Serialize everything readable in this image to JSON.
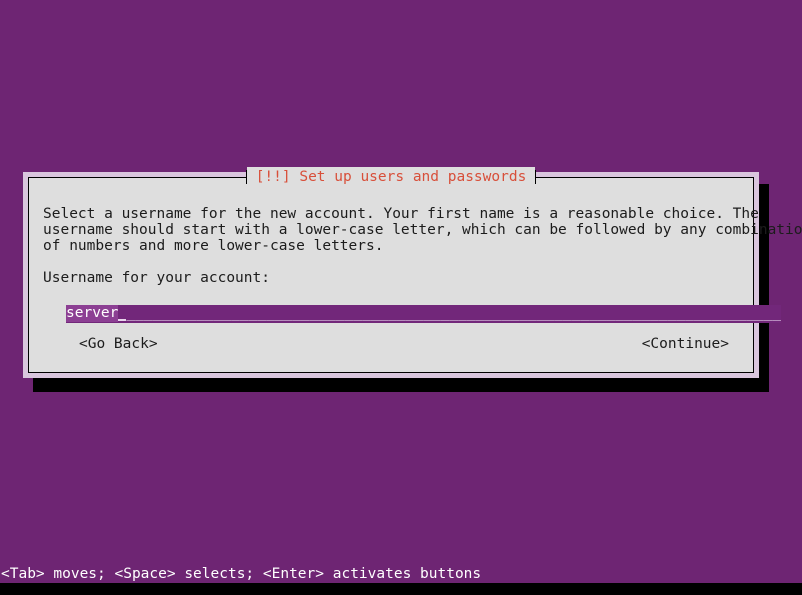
{
  "screen": {
    "background_color": "#6e2573",
    "bottom_strip_color": "#000000"
  },
  "dialog": {
    "title": "[!!] Set up users and passwords",
    "title_color": "#d84f3a",
    "frame_color": "#d9c6dd",
    "panel_color": "#dedede",
    "border_color": "#000000",
    "shadow_color": "#000000",
    "body_lines": [
      "Select a username for the new account. Your first name is a reasonable choice. The",
      "username should start with a lower-case letter, which can be followed by any combination",
      "of numbers and more lower-case letters."
    ],
    "prompt_label": "Username for your account:",
    "input": {
      "value": "server",
      "placeholder": "",
      "selected": true,
      "selection_color": "#8c3f93",
      "field_color": "#72277a",
      "text_color": "#ffffff",
      "blank_color": "#e8d5ec",
      "blank_fill": "_________________________________________________________________________________"
    },
    "buttons": {
      "go_back": "<Go Back>",
      "continue": "<Continue>"
    }
  },
  "status_bar": {
    "text": "<Tab> moves; <Space> selects; <Enter> activates buttons",
    "background_color": "#6e2573",
    "text_color": "#ffffff"
  }
}
